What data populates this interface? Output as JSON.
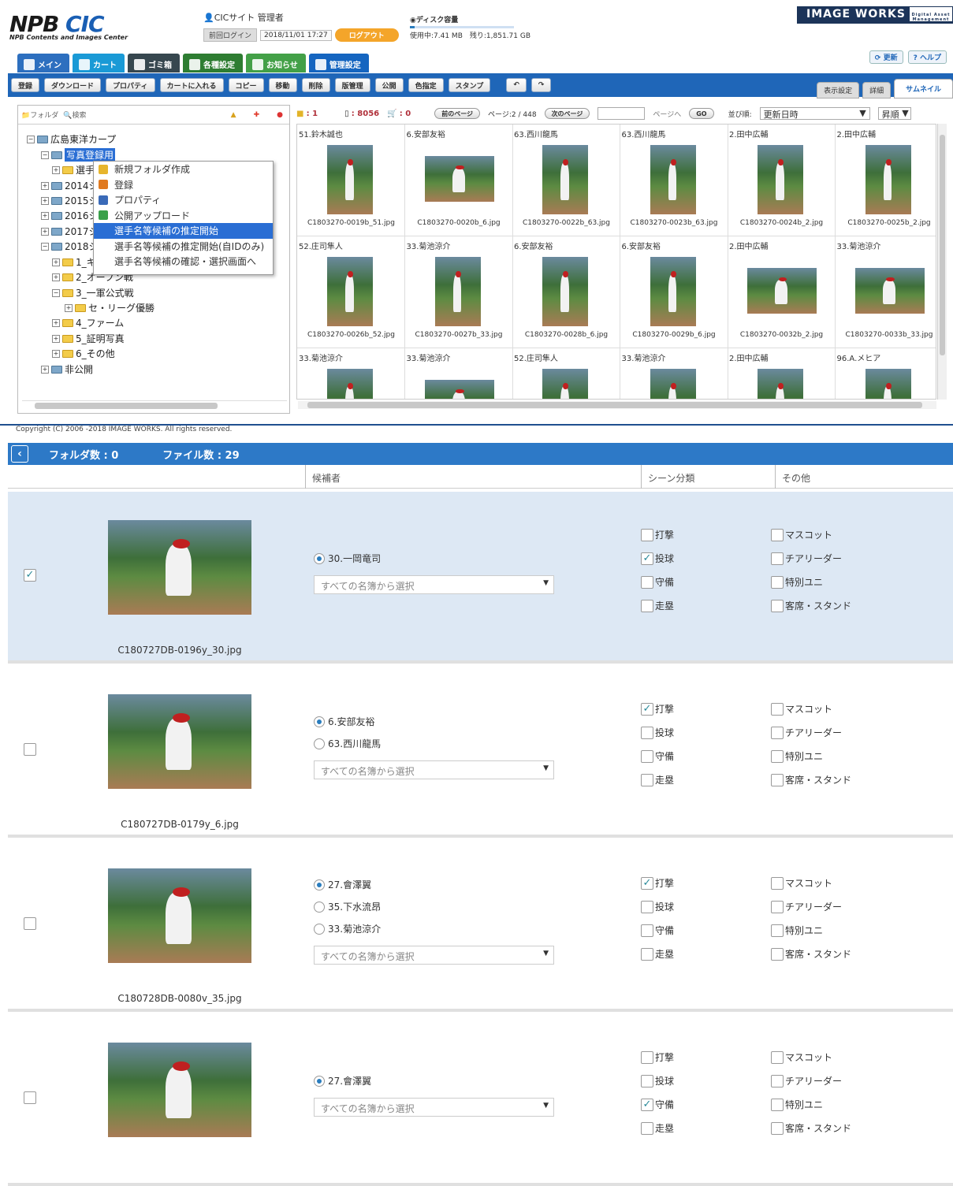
{
  "header": {
    "logo_main": "NPB",
    "logo_cic": "CIC",
    "logo_sub": "NPB Contents and Images Center",
    "user_label": "CICサイト 管理者",
    "last_login_label": "前回ログイン",
    "last_login_time": "2018/11/01 17:27",
    "logout_label": "ログアウト",
    "disk_title": "ディスク容量",
    "disk_usage": "使用中:7.41 MB　残り:1,851.71 GB",
    "brand": "IMAGE WORKS",
    "brand_sub": "Digital Asset Management",
    "refresh_label": "更新",
    "help_label": "ヘルプ"
  },
  "tabs": [
    {
      "label": "メイン",
      "color": "#2d6fbf"
    },
    {
      "label": "カート",
      "color": "#1a9ad6"
    },
    {
      "label": "ゴミ箱",
      "color": "#37474f"
    },
    {
      "label": "各種設定",
      "color": "#2e7d32"
    },
    {
      "label": "お知らせ",
      "color": "#43a047"
    },
    {
      "label": "管理設定",
      "color": "#1565c0"
    }
  ],
  "toolbar": [
    "登録",
    "ダウンロード",
    "プロパティ",
    "カートに入れる",
    "コピー",
    "移動",
    "削除",
    "版管理",
    "公開",
    "色指定",
    "スタンプ"
  ],
  "view_tabs": {
    "display_settings": "表示設定",
    "detail": "詳細",
    "thumbnail": "サムネイル"
  },
  "tree": {
    "tab_folder": "フォルダ",
    "tab_search": "検索",
    "root": "広島東洋カープ",
    "selected": "写真登録用",
    "items": [
      "選手",
      "2014シ",
      "2015シ",
      "2016シ",
      "2017シ",
      "2018シ",
      "1_キ",
      "2_オープン戦",
      "3_一軍公式戦",
      "セ・リーグ優勝",
      "4_ファーム",
      "5_証明写真",
      "6_その他",
      "非公開"
    ]
  },
  "context_menu": [
    "新規フォルダ作成",
    "登録",
    "プロパティ",
    "公開アップロード",
    "選手名等候補の推定開始",
    "選手名等候補の推定開始(自IDのみ)",
    "選手名等候補の確認・選択画面へ"
  ],
  "gridbar": {
    "folders": ": 1",
    "files": ": 8056",
    "cart": ": 0",
    "prev": "前のページ",
    "page": "ページ:2 / 448",
    "next": "次のページ",
    "page_to": "ページへ",
    "go": "GO",
    "sort_label": "並び順:",
    "sort_value": "更新日時",
    "order": "昇順"
  },
  "grid": [
    {
      "name": "51.鈴木誠也",
      "file": "C1803270-0019b_51.jpg",
      "wide": false
    },
    {
      "name": "6.安部友裕",
      "file": "C1803270-0020b_6.jpg",
      "wide": true
    },
    {
      "name": "63.西川龍馬",
      "file": "C1803270-0022b_63.jpg",
      "wide": false
    },
    {
      "name": "63.西川龍馬",
      "file": "C1803270-0023b_63.jpg",
      "wide": false
    },
    {
      "name": "2.田中広輔",
      "file": "C1803270-0024b_2.jpg",
      "wide": false
    },
    {
      "name": "2.田中広輔",
      "file": "C1803270-0025b_2.jpg",
      "wide": false
    },
    {
      "name": "52.庄司隼人",
      "file": "C1803270-0026b_52.jpg",
      "wide": false
    },
    {
      "name": "33.菊池涼介",
      "file": "C1803270-0027b_33.jpg",
      "wide": false
    },
    {
      "name": "6.安部友裕",
      "file": "C1803270-0028b_6.jpg",
      "wide": false
    },
    {
      "name": "6.安部友裕",
      "file": "C1803270-0029b_6.jpg",
      "wide": false
    },
    {
      "name": "2.田中広輔",
      "file": "C1803270-0032b_2.jpg",
      "wide": true
    },
    {
      "name": "33.菊池涼介",
      "file": "C1803270-0033b_33.jpg",
      "wide": true
    },
    {
      "name": "33.菊池涼介",
      "file": "",
      "wide": false
    },
    {
      "name": "33.菊池涼介",
      "file": "",
      "wide": true
    },
    {
      "name": "52.庄司隼人",
      "file": "",
      "wide": false
    },
    {
      "name": "33.菊池涼介",
      "file": "",
      "wide": false
    },
    {
      "name": "2.田中広輔",
      "file": "",
      "wide": false
    },
    {
      "name": "96.A.メヒア",
      "file": "",
      "wide": false
    }
  ],
  "copyright": "Copyright (C) 2006 -2018 IMAGE WORKS. All rights reserved.",
  "panel": {
    "folder_count": "フォルダ数 : 0",
    "file_count": "ファイル数 : 29",
    "col_candidates": "候補者",
    "col_scene": "シーン分類",
    "col_other": "その他",
    "select_placeholder": "すべての名簿から選択",
    "scene_options": [
      "打撃",
      "投球",
      "守備",
      "走塁"
    ],
    "other_options": [
      "マスコット",
      "チアリーダー",
      "特別ユニ",
      "客席・スタンド"
    ],
    "records": [
      {
        "file": "C180727DB-0196y_30.jpg",
        "selected": true,
        "candidates": [
          "30.一岡竜司"
        ],
        "scene_checked": [
          1
        ],
        "other_checked": []
      },
      {
        "file": "C180727DB-0179y_6.jpg",
        "selected": false,
        "candidates": [
          "6.安部友裕",
          "63.西川龍馬"
        ],
        "scene_checked": [
          0
        ],
        "other_checked": []
      },
      {
        "file": "C180728DB-0080v_35.jpg",
        "selected": false,
        "candidates": [
          "27.會澤翼",
          "35.下水流昂",
          "33.菊池涼介"
        ],
        "scene_checked": [
          0
        ],
        "other_checked": []
      },
      {
        "file": "",
        "selected": false,
        "candidates": [
          "27.會澤翼"
        ],
        "scene_checked": [
          2
        ],
        "other_checked": []
      }
    ]
  }
}
